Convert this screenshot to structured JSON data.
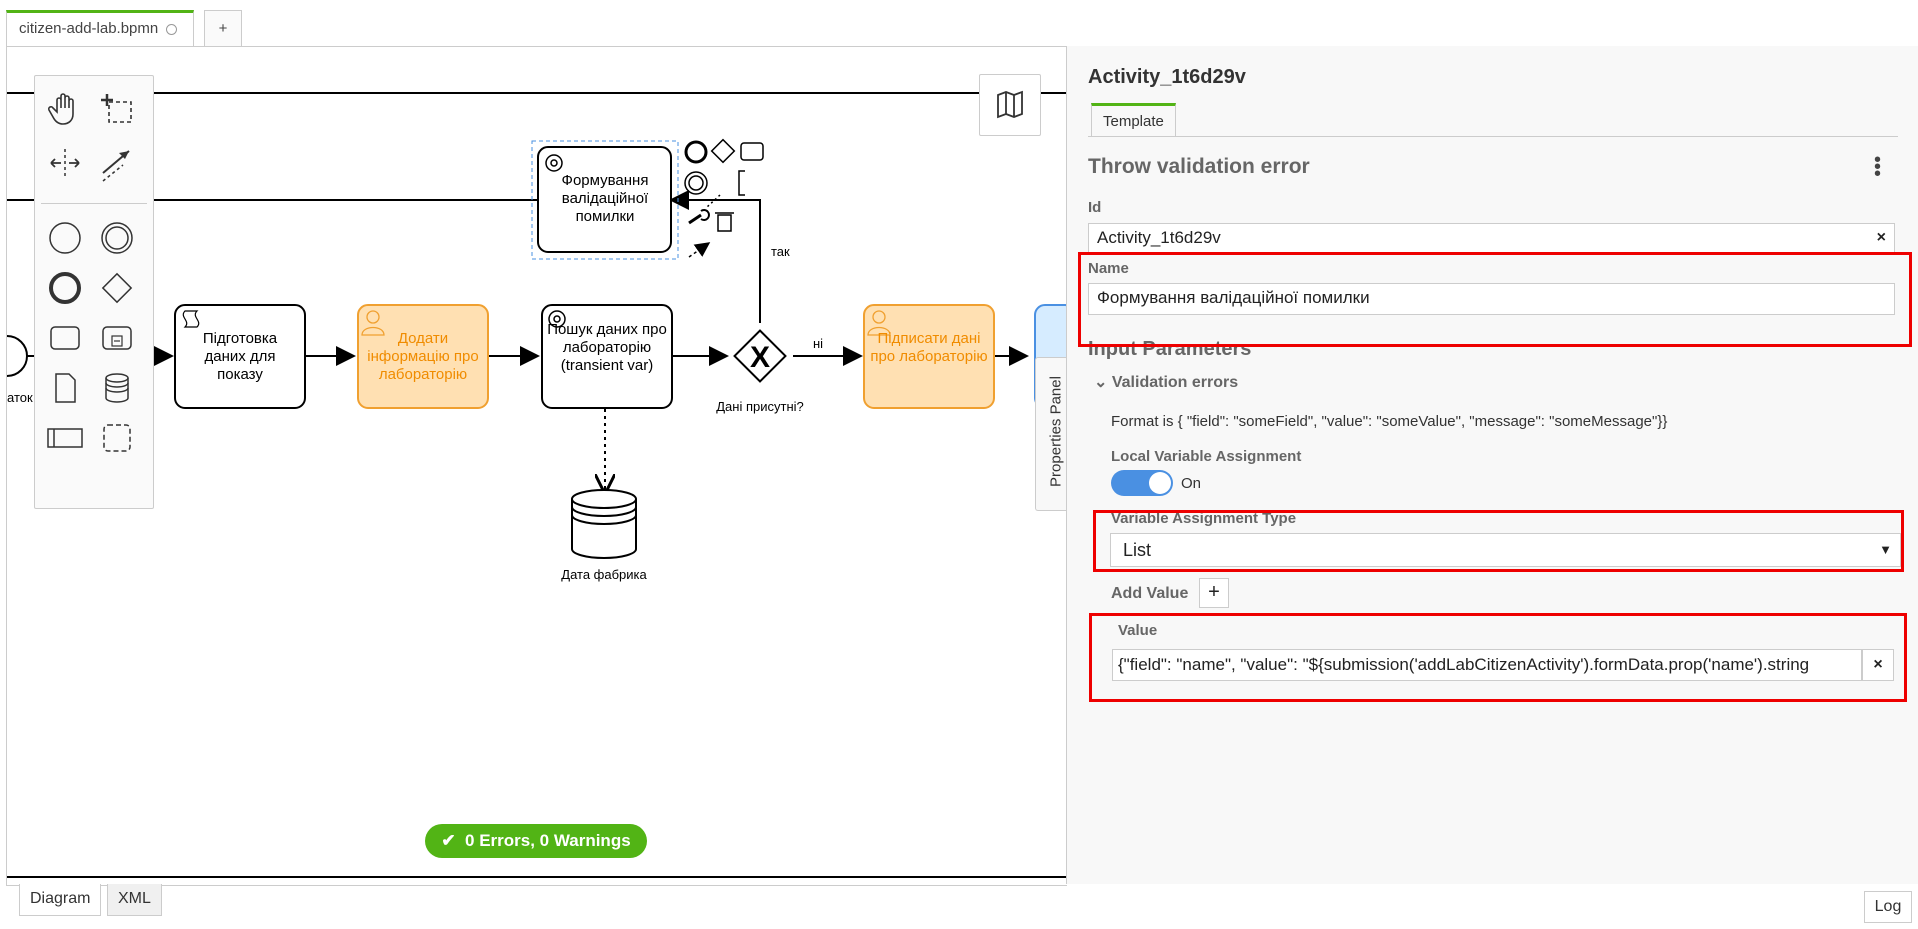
{
  "tabs": {
    "active_label": "citizen-add-lab.bpmn",
    "add_label": "+"
  },
  "diagram": {
    "task_validation": "Формування валідаційної помилки",
    "task_prepare": "Підготовка даних для показу",
    "task_add_info": "Додати інформацію про лабораторію",
    "task_search": "Пошук даних про лабораторію (transient var)",
    "task_sign": "Підписати дані про лабораторію",
    "gateway_label": "Дані присутні?",
    "flow_yes": "так",
    "flow_no": "ні",
    "datastore_label": "Дата фабрика",
    "start_label_partial": "аток"
  },
  "status": {
    "text": "0 Errors, 0 Warnings",
    "color": "#52b415"
  },
  "properties_panel": {
    "toggle_label": "Properties Panel",
    "element_id_title": "Activity_1t6d29v",
    "template_tab": "Template",
    "group_title": "Throw validation error",
    "id_label": "Id",
    "id_value": "Activity_1t6d29v",
    "name_label": "Name",
    "name_value": "Формування валідаційної помилки",
    "input_params_title": "Input Parameters",
    "validation_errors_label": "Validation errors",
    "format_note": "Format is { \"field\": \"someField\", \"value\": \"someValue\", \"message\": \"someMessage\"}}",
    "local_var_label": "Local Variable Assignment",
    "local_var_state": "On",
    "var_type_label": "Variable Assignment Type",
    "var_type_value": "List",
    "add_value_label": "Add Value",
    "add_value_btn": "+",
    "value_label": "Value",
    "value_value": "{\"field\": \"name\", \"value\": \"${submission('addLabCitizenActivity').formData.prop('name').string"
  },
  "bottom": {
    "diagram_tab": "Diagram",
    "xml_tab": "XML",
    "log_button": "Log"
  },
  "colors": {
    "accent_green": "#52b415",
    "user_task_fill": "#ffe0b2",
    "user_task_stroke": "#f0a030",
    "toggle_blue": "#4a90e2",
    "highlight_red": "#e00000"
  },
  "icons": {
    "hand": "hand-tool-icon",
    "lasso": "lasso-tool-icon",
    "space": "space-tool-icon",
    "connect": "global-connect-icon",
    "minimap": "map-icon"
  }
}
